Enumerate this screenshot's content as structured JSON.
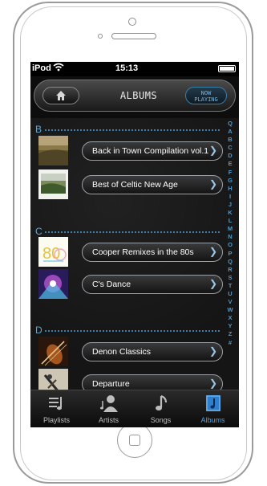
{
  "status_bar": {
    "carrier": "iPod",
    "time": "15:13"
  },
  "nav": {
    "title": "ALBUMS",
    "now_playing_line1": "NOW",
    "now_playing_line2": "PLAYING"
  },
  "sections": [
    {
      "letter": "B",
      "albums": [
        {
          "title": "Back in Town Compilation vol.1"
        },
        {
          "title": "Best of Celtic New Age"
        }
      ]
    },
    {
      "letter": "C",
      "albums": [
        {
          "title": "Cooper Remixes in the 80s"
        },
        {
          "title": "C's Dance"
        }
      ]
    },
    {
      "letter": "D",
      "albums": [
        {
          "title": "Denon Classics"
        },
        {
          "title": "Departure"
        }
      ]
    }
  ],
  "index_letters": [
    "Q",
    "A",
    "B",
    "C",
    "D",
    "E",
    "F",
    "G",
    "H",
    "I",
    "J",
    "K",
    "L",
    "M",
    "N",
    "O",
    "P",
    "Q",
    "R",
    "S",
    "T",
    "U",
    "V",
    "W",
    "X",
    "Y",
    "Z",
    "#"
  ],
  "tabs": [
    {
      "label": "Playlists",
      "icon": "playlists-icon"
    },
    {
      "label": "Artists",
      "icon": "artists-icon"
    },
    {
      "label": "Songs",
      "icon": "songs-icon"
    },
    {
      "label": "Albums",
      "icon": "albums-icon",
      "active": true
    }
  ],
  "colors": {
    "accent": "#4aa3e0",
    "section": "#5aa8d8",
    "screen_bg": "#0d0d0d"
  }
}
